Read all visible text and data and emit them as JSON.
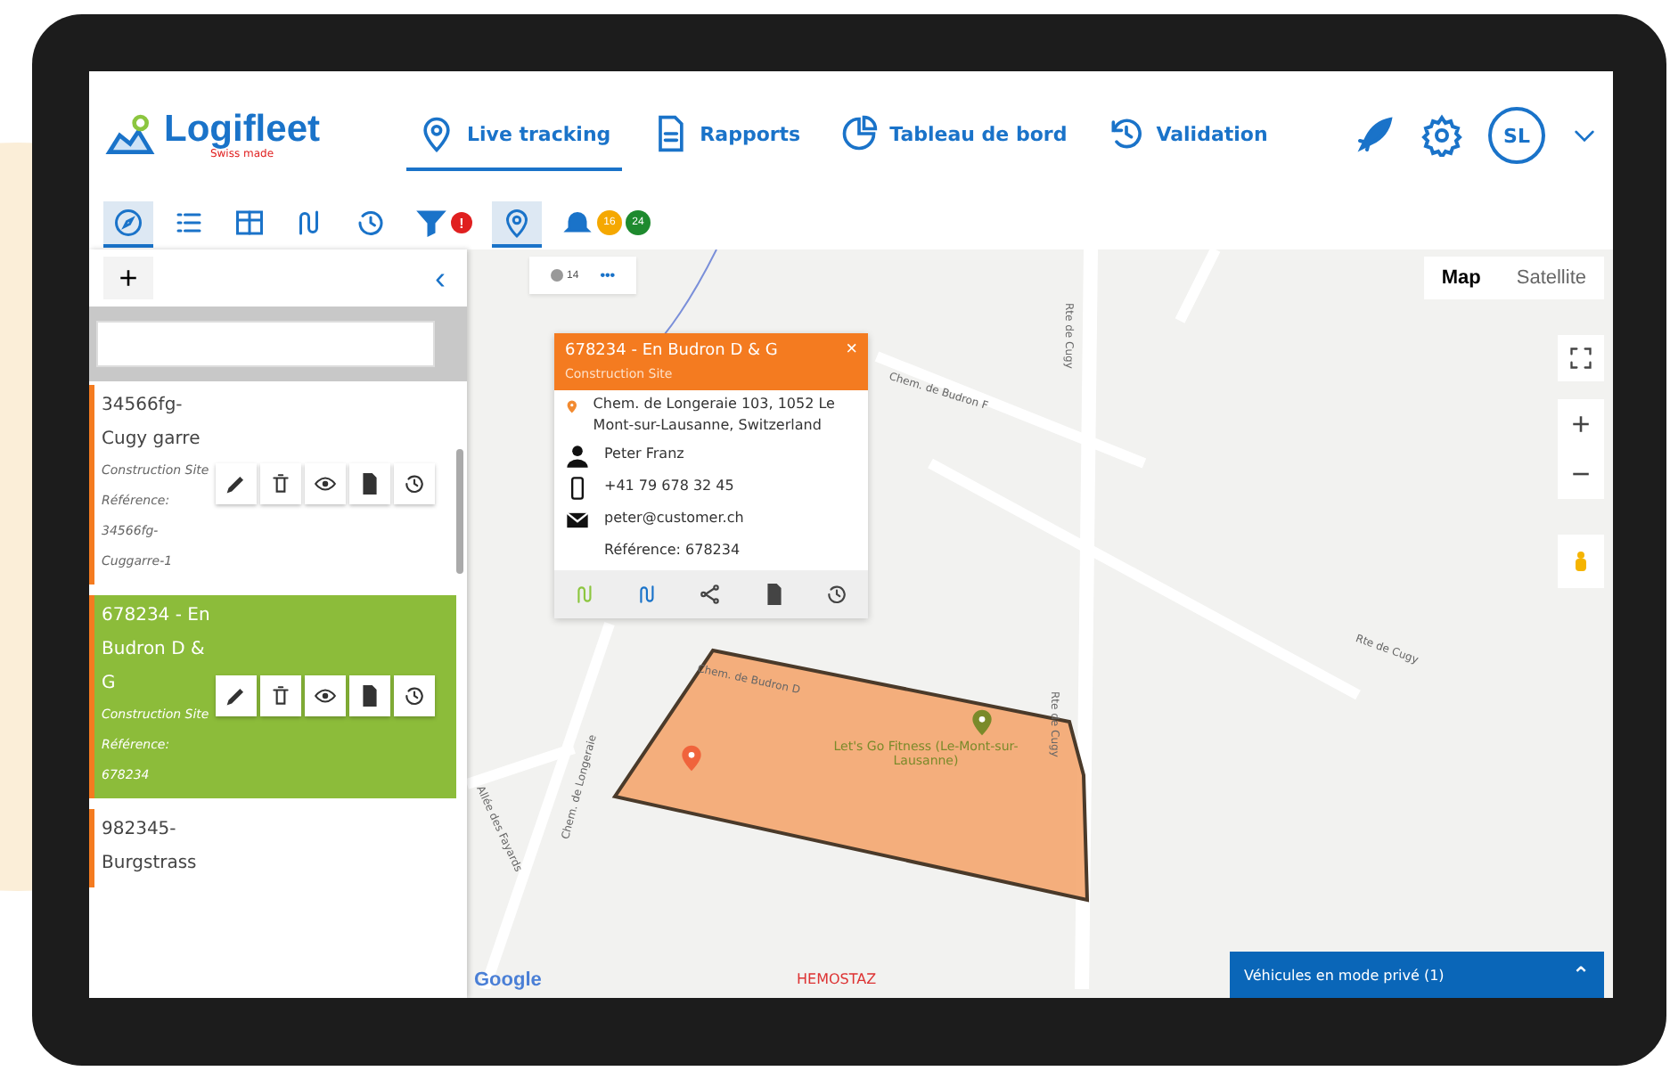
{
  "header": {
    "logo": {
      "name": "Logifleet",
      "tagline": "Swiss made"
    },
    "nav": [
      {
        "label": "Live tracking",
        "selected": true
      },
      {
        "label": "Rapports",
        "selected": false
      },
      {
        "label": "Tableau de bord",
        "selected": false
      },
      {
        "label": "Validation",
        "selected": false
      }
    ],
    "user": {
      "initials": "SL"
    }
  },
  "toolbar": [
    {
      "selected": true
    },
    {
      "selected": false
    },
    {
      "selected": false
    },
    {
      "selected": false
    },
    {
      "selected": false
    },
    {
      "selected": false,
      "badge": {
        "text": "!",
        "color": "#e02020"
      }
    },
    {
      "selected": true
    },
    {
      "selected": false,
      "counts": [
        {
          "text": "16",
          "color": "#f5a800"
        },
        {
          "text": "24",
          "color": "#1e8a2e"
        }
      ]
    }
  ],
  "sidebar": {
    "add": "+",
    "collapse": "‹",
    "items": [
      {
        "title": "34566fg-Cugy garre",
        "type": "Construction Site",
        "reference": "Référence: 34566fg-Cuggarre-1",
        "selected": false
      },
      {
        "title": "678234 - En Budron D & G",
        "type": "Construction Site",
        "reference": "Référence: 678234",
        "selected": true
      },
      {
        "title": "982345-Burgstrass",
        "selected": false
      }
    ]
  },
  "map": {
    "controls": {
      "count": "14",
      "more": "•••"
    },
    "views": [
      {
        "label": "Map",
        "selected": true
      },
      {
        "label": "Satellite",
        "selected": false
      }
    ],
    "zoom": {
      "in": "+",
      "out": "−"
    },
    "popup": {
      "title": "678234 - En Budron D & G",
      "subtitle": "Construction Site",
      "close": "×",
      "address": "Chem. de Longeraie 103, 1052 Le Mont-sur-Lausanne, Switzerland",
      "contact": "Peter Franz",
      "phone": "+41 79 678 32 45",
      "email": "peter@customer.ch",
      "reference": "Référence: 678234"
    },
    "places": [
      {
        "label": "Let's Go Fitness (Le-Mont-sur-Lausanne)",
        "color": "#7a8a2a"
      }
    ],
    "streets": [
      "Chem. de Budron D",
      "Chem. de Budron F",
      "Rte de Cugy",
      "Rte de Cugy",
      "Rte de Cugy",
      "Chem. de Longeraie",
      "Allée des Fayards",
      "HEMOSTAZ"
    ],
    "attribution": "Google",
    "private_bar": {
      "label": "Véhicules en mode privé (1)",
      "toggle": "⌃"
    }
  }
}
